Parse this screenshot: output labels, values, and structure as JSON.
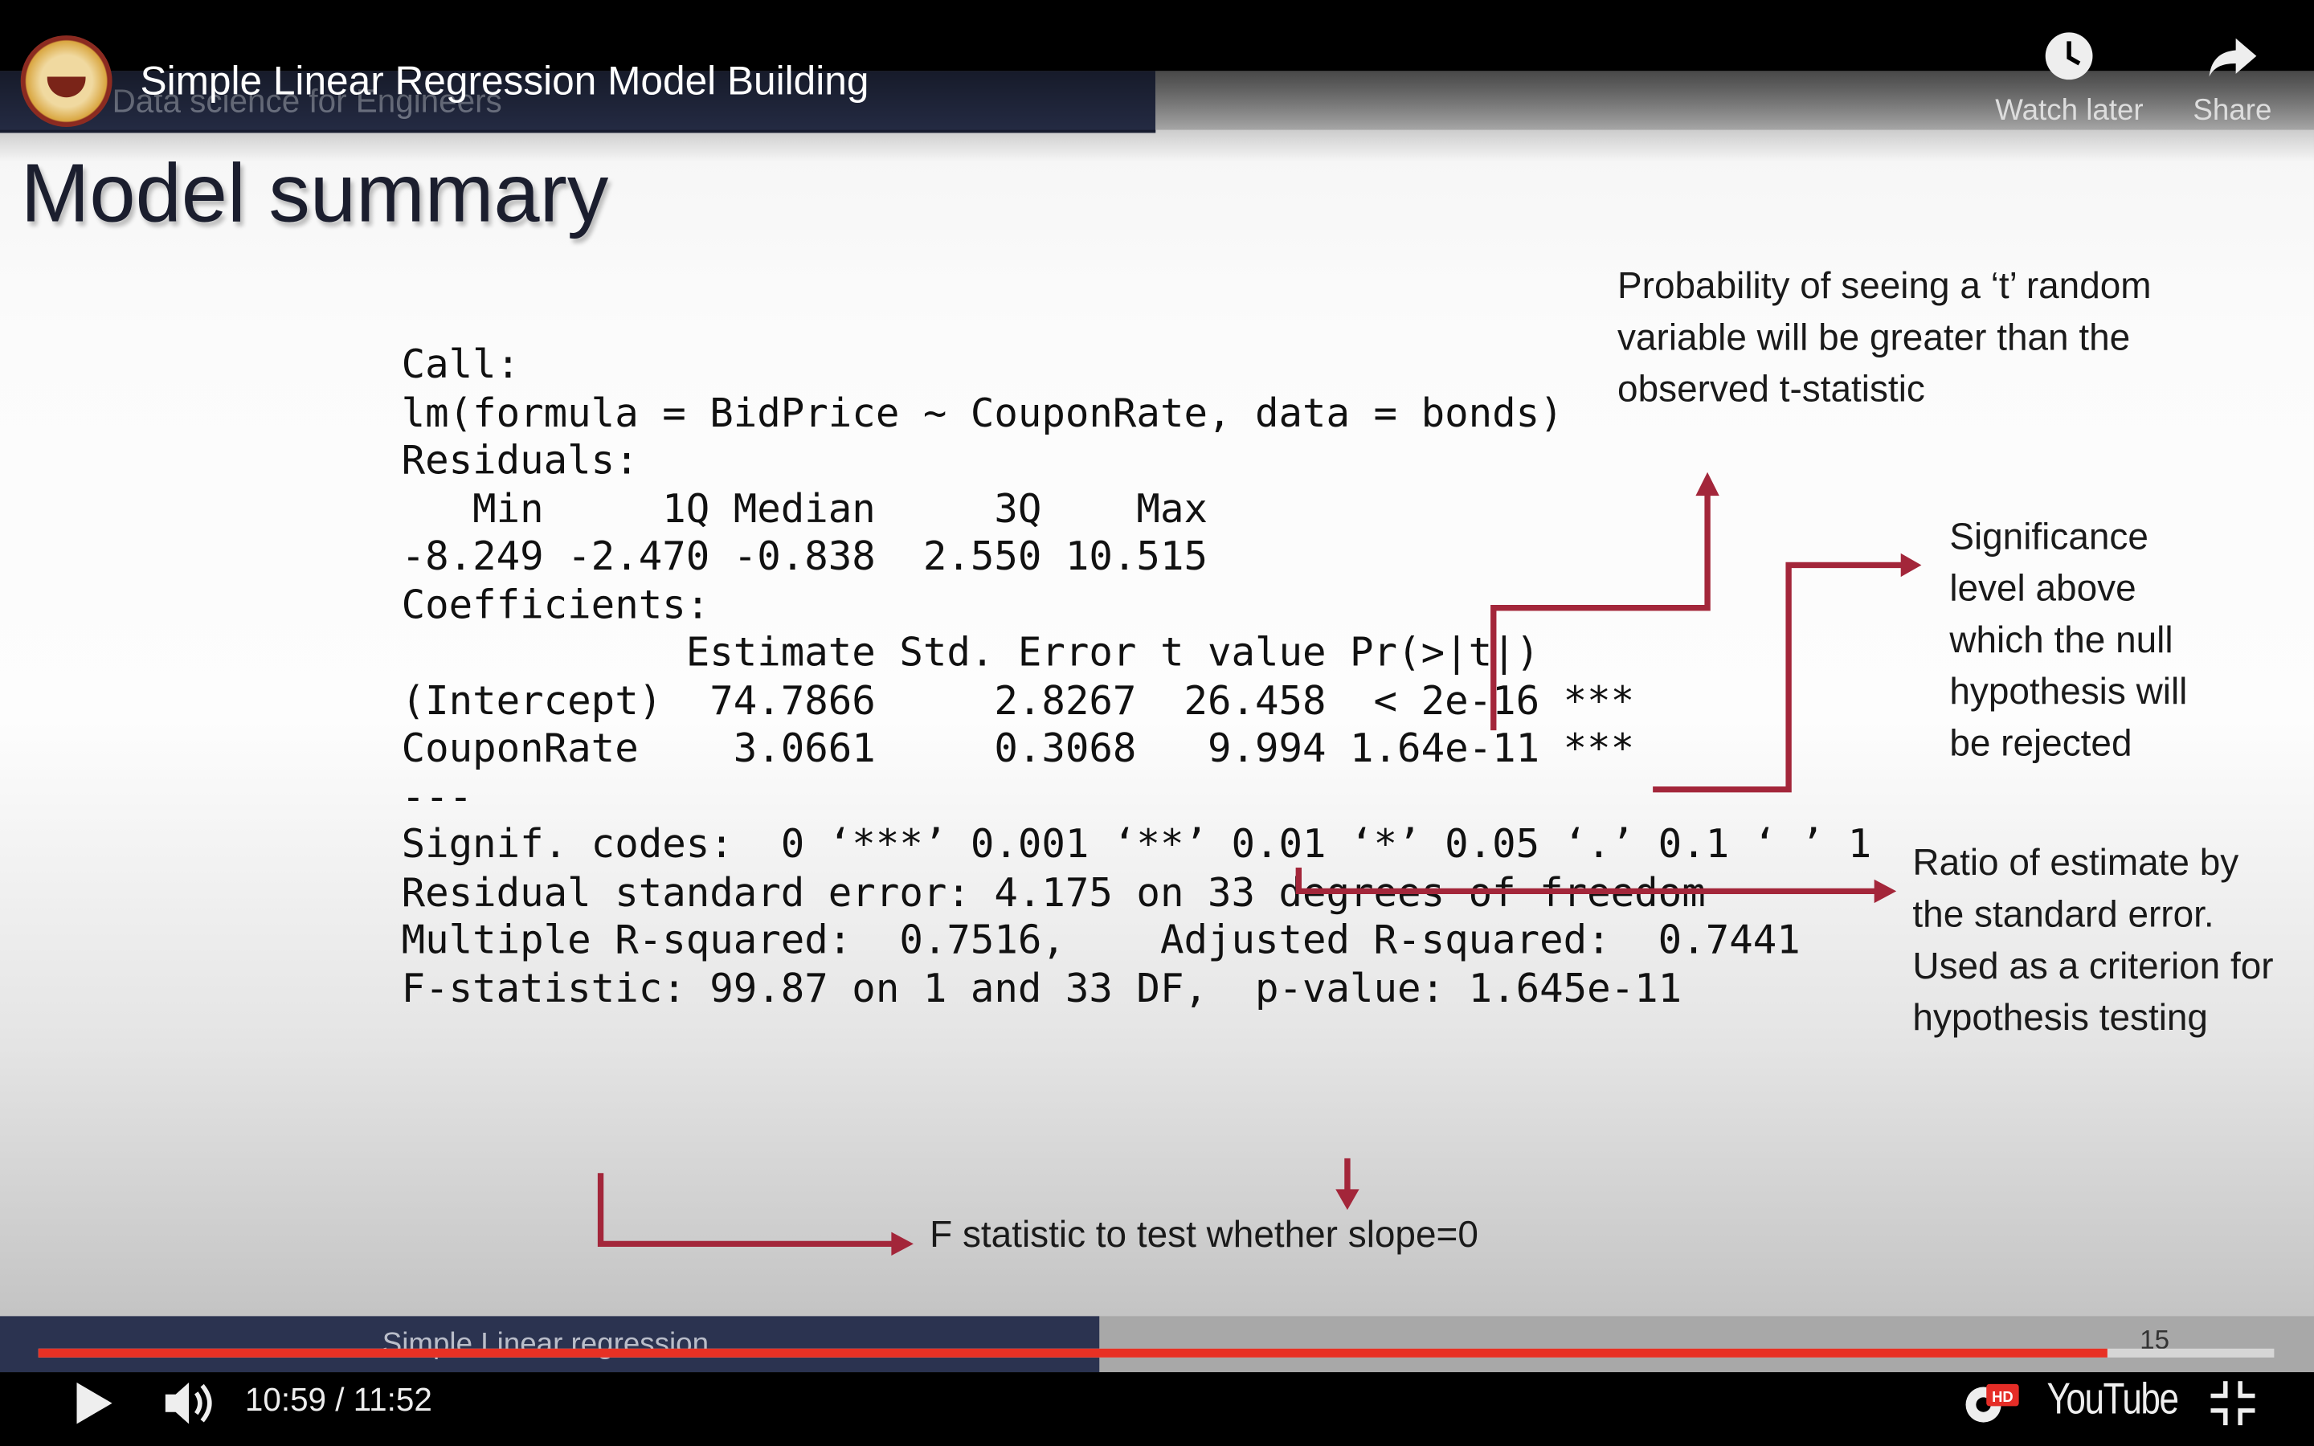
{
  "video": {
    "title": "Simple Linear Regression Model Building",
    "watch_later": "Watch later",
    "share": "Share",
    "time": "10:59 / 11:52",
    "progress": 0.9256,
    "hd_badge": "HD",
    "brand": "YouTube"
  },
  "slide": {
    "header": "Data science for Engineers",
    "title": "Model summary",
    "footer": "Simple Linear regression",
    "page": "15",
    "code": [
      "Call:",
      "lm(formula = BidPrice ~ CouponRate, data = bonds)",
      "",
      "Residuals:",
      "   Min     1Q Median     3Q    Max",
      "-8.249 -2.470 -0.838  2.550 10.515",
      "",
      "Coefficients:",
      "            Estimate Std. Error t value Pr(>|t|)    ",
      "(Intercept)  74.7866     2.8267  26.458  < 2e-16 ***",
      "CouponRate    3.0661     0.3068   9.994 1.64e-11 ***",
      "---",
      "Signif. codes:  0 ‘***’ 0.001 ‘**’ 0.01 ‘*’ 0.05 ‘.’ 0.1 ‘ ’ 1",
      "",
      "Residual standard error: 4.175 on 33 degrees of freedom",
      "Multiple R-squared:  0.7516,    Adjusted R-squared:  0.7441 ",
      "F-statistic: 99.87 on 1 and 33 DF,  p-value: 1.645e-11"
    ],
    "annotations": {
      "probability": "Probability of seeing a ‘t’ random variable will be greater than the observed t-statistic",
      "significance": "Significance level above which the null hypothesis will be rejected",
      "ratio": "Ratio of estimate by the standard error. Used as a criterion for hypothesis testing",
      "fstat": "F statistic to test whether slope=0"
    },
    "arrow_color": "#a3263a"
  }
}
